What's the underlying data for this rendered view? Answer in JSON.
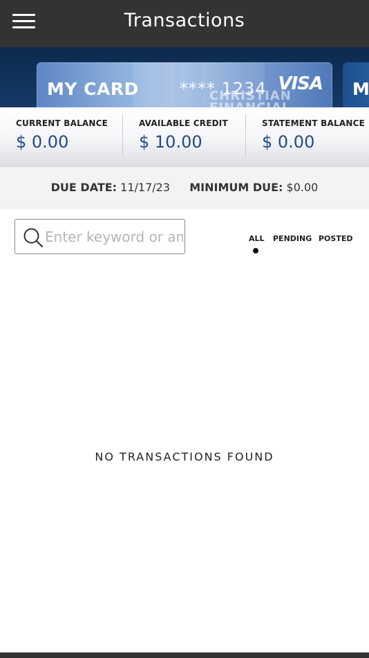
{
  "header": {
    "title": "Transactions",
    "menu_icon": "hamburger-menu-icon"
  },
  "card": {
    "name": "MY CARD",
    "number": "**** 1234",
    "brand": "VISA",
    "watermark_line1": "CHRISTIAN",
    "watermark_line2": "FINANCIAL",
    "next_card_name": "M"
  },
  "balances": [
    {
      "label": "CURRENT BALANCE",
      "value": "$ 0.00"
    },
    {
      "label": "AVAILABLE CREDIT",
      "value": "$ 10.00"
    },
    {
      "label": "STATEMENT BALANCE",
      "value": "$ 0.00"
    }
  ],
  "due": {
    "date_label": "DUE DATE:",
    "date_value": "11/17/23",
    "min_label": "MINIMUM DUE:",
    "min_value": "$0.00"
  },
  "search": {
    "placeholder": "Enter keyword or amount",
    "value": "",
    "icon": "search-icon"
  },
  "filters": {
    "all": "ALL",
    "pending": "PENDING",
    "posted": "POSTED",
    "selected": "ALL"
  },
  "empty_message": "NO TRANSACTIONS FOUND",
  "colors": {
    "header_bg": "#333333",
    "card_strip_bg": "#143a66",
    "balance_value": "#23498a"
  }
}
